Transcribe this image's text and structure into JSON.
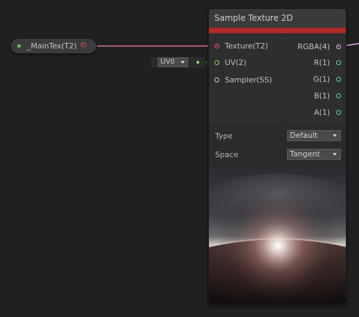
{
  "property_node": {
    "label": "_MainTex(T2)",
    "type_color": "#6dbf5a",
    "port_color": "#e25a6e"
  },
  "uv_input": {
    "value": "UV0"
  },
  "node": {
    "title": "Sample Texture 2D",
    "accent_color": "#b02a26",
    "inputs": [
      {
        "label": "Texture(T2)",
        "color": "#e25a6e"
      },
      {
        "label": "UV(2)",
        "color": "#8fdc7a"
      },
      {
        "label": "Sampler(SS)",
        "color": "#d8d8d8"
      }
    ],
    "outputs": [
      {
        "label": "RGBA(4)",
        "color": "#e4b0e8"
      },
      {
        "label": "R(1)",
        "color": "#65d8e0"
      },
      {
        "label": "G(1)",
        "color": "#65d8e0"
      },
      {
        "label": "B(1)",
        "color": "#65d8e0"
      },
      {
        "label": "A(1)",
        "color": "#65d8e0"
      }
    ],
    "settings": {
      "type_label": "Type",
      "type_value": "Default",
      "space_label": "Space",
      "space_value": "Tangent"
    }
  }
}
